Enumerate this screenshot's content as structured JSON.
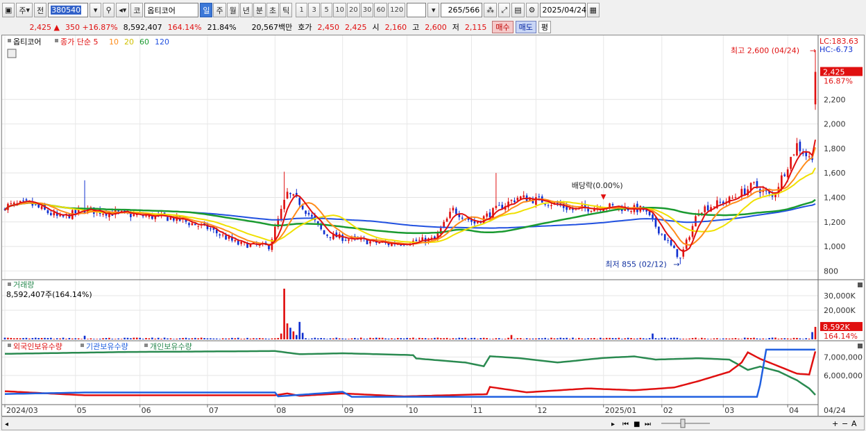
{
  "toolbar": {
    "market_type": "주",
    "prev": "전",
    "code": "380540",
    "market_badge": "코",
    "name": "옵티코어",
    "periods": [
      "일",
      "주",
      "월",
      "년",
      "분",
      "초",
      "틱"
    ],
    "active_period": "일",
    "minute_options": [
      "1",
      "3",
      "5",
      "10",
      "20",
      "30",
      "60",
      "120"
    ],
    "count": "265",
    "count_total": "/566",
    "date": "2025/04/24"
  },
  "quote": {
    "price": "2,425",
    "change_mark": "▲",
    "change": "350",
    "change_pct": "+16.87%",
    "volume": "8,592,407",
    "volume_ratio": "164.14%",
    "turnover": "21.84%",
    "amount": "20,567백만",
    "ask_label": "호가",
    "ask": "2,450",
    "bid": "2,425",
    "open_label": "시",
    "open": "2,160",
    "high_label": "고",
    "high": "2,600",
    "low_label": "저",
    "low": "2,115",
    "buy_label": "매수",
    "sell_label": "매도",
    "avg_label": "평"
  },
  "colors": {
    "up": "#e01010",
    "down": "#1030d0",
    "ma5": "#e01010",
    "ma10": "#ff8c1a",
    "ma20": "#f0e000",
    "ma60": "#1a9a30",
    "ma120": "#2050e0",
    "foreign": "#e01010",
    "institution": "#2060e0",
    "individual": "#2a8a50"
  },
  "chart_data": [
    {
      "type": "candlestick",
      "legend": {
        "name": "옵티코어",
        "series_label": "종가 단순",
        "ma_periods": [
          "5",
          "10",
          "20",
          "60",
          "120"
        ]
      },
      "lc": "LC:183.63",
      "hc": "HC:-6.73",
      "y_ticks": [
        "2,200",
        "2,000",
        "1,800",
        "1,600",
        "1,400",
        "1,200",
        "1,000",
        "800"
      ],
      "ylim": [
        740,
        2700
      ],
      "last_price_label": "2,425",
      "last_pct_label": "16.87%",
      "high_annotation": "최고 2,600 (04/24)",
      "low_annotation": "최저 855 (02/12)",
      "dividend_annotation": "배당락(0.00%)",
      "x_ticks": [
        "2024/03",
        "05",
        "06",
        "07",
        "08",
        "09",
        "10",
        "11",
        "12",
        "2025/01",
        "02",
        "03",
        "04"
      ],
      "x_tick_index": [
        0,
        23,
        44,
        66,
        88,
        110,
        131,
        152,
        173,
        195,
        214,
        234,
        255
      ],
      "current_date_label": "04/24",
      "n_days": 265,
      "keypoints": [
        [
          0,
          1330
        ],
        [
          8,
          1350
        ],
        [
          18,
          1230
        ],
        [
          26,
          1300
        ],
        [
          40,
          1260
        ],
        [
          55,
          1230
        ],
        [
          66,
          1150
        ],
        [
          76,
          1020
        ],
        [
          86,
          1000
        ],
        [
          92,
          1430
        ],
        [
          96,
          1360
        ],
        [
          104,
          1100
        ],
        [
          112,
          1060
        ],
        [
          125,
          1020
        ],
        [
          140,
          1060
        ],
        [
          146,
          1300
        ],
        [
          153,
          1190
        ],
        [
          160,
          1300
        ],
        [
          167,
          1400
        ],
        [
          176,
          1370
        ],
        [
          185,
          1300
        ],
        [
          195,
          1330
        ],
        [
          208,
          1300
        ],
        [
          214,
          1100
        ],
        [
          220,
          900
        ],
        [
          226,
          1300
        ],
        [
          236,
          1380
        ],
        [
          244,
          1500
        ],
        [
          250,
          1400
        ],
        [
          258,
          1830
        ],
        [
          262,
          1720
        ],
        [
          263,
          1750
        ],
        [
          264,
          2425
        ]
      ]
    },
    {
      "type": "bar",
      "title": "거래량",
      "info": "8,592,407주(164.14%)",
      "y_ticks": [
        "30,000K",
        "20,000K"
      ],
      "ylim": [
        0,
        40000
      ],
      "last_label": "8,592K",
      "last_pct": "164.14%",
      "spikes": [
        [
          26,
          2500
        ],
        [
          90,
          4000
        ],
        [
          91,
          34800
        ],
        [
          92,
          11000
        ],
        [
          93,
          8000
        ],
        [
          94,
          5500
        ],
        [
          95,
          3000
        ],
        [
          96,
          12000
        ],
        [
          97,
          4500
        ],
        [
          165,
          3000
        ],
        [
          211,
          4000
        ],
        [
          263,
          5000
        ],
        [
          264,
          8592
        ]
      ]
    },
    {
      "type": "line",
      "series": [
        {
          "name": "외국인보유수량"
        },
        {
          "name": "기관보유수량"
        },
        {
          "name": "개인보유수량"
        }
      ],
      "y_ticks": [
        "7,000,000",
        "6,000,000"
      ],
      "ylim": [
        4500000,
        7800000
      ],
      "foreign": [
        [
          0,
          5150
        ],
        [
          26,
          4930
        ],
        [
          88,
          4930
        ],
        [
          92,
          5030
        ],
        [
          96,
          4900
        ],
        [
          110,
          5030
        ],
        [
          130,
          4870
        ],
        [
          157,
          4990
        ],
        [
          158,
          5380
        ],
        [
          170,
          5090
        ],
        [
          190,
          5300
        ],
        [
          205,
          5200
        ],
        [
          218,
          5350
        ],
        [
          226,
          5700
        ],
        [
          236,
          6200
        ],
        [
          240,
          6700
        ],
        [
          242,
          7250
        ],
        [
          246,
          6900
        ],
        [
          252,
          6500
        ],
        [
          258,
          6100
        ],
        [
          262,
          6050
        ],
        [
          264,
          7300
        ]
      ],
      "institution": [
        [
          0,
          5000
        ],
        [
          26,
          5080
        ],
        [
          88,
          5080
        ],
        [
          89,
          4870
        ],
        [
          110,
          5120
        ],
        [
          113,
          4850
        ],
        [
          245,
          4850
        ],
        [
          246,
          5500
        ],
        [
          248,
          7400
        ],
        [
          264,
          7400
        ]
      ],
      "individual": [
        [
          0,
          7170
        ],
        [
          40,
          7270
        ],
        [
          88,
          7320
        ],
        [
          96,
          7150
        ],
        [
          110,
          7200
        ],
        [
          133,
          7100
        ],
        [
          134,
          6920
        ],
        [
          150,
          6700
        ],
        [
          156,
          6500
        ],
        [
          158,
          7040
        ],
        [
          168,
          6930
        ],
        [
          180,
          6700
        ],
        [
          195,
          6950
        ],
        [
          205,
          7030
        ],
        [
          212,
          6860
        ],
        [
          226,
          6930
        ],
        [
          236,
          6860
        ],
        [
          242,
          6300
        ],
        [
          246,
          6480
        ],
        [
          252,
          6220
        ],
        [
          258,
          5740
        ],
        [
          262,
          5300
        ],
        [
          264,
          4950
        ]
      ]
    }
  ]
}
